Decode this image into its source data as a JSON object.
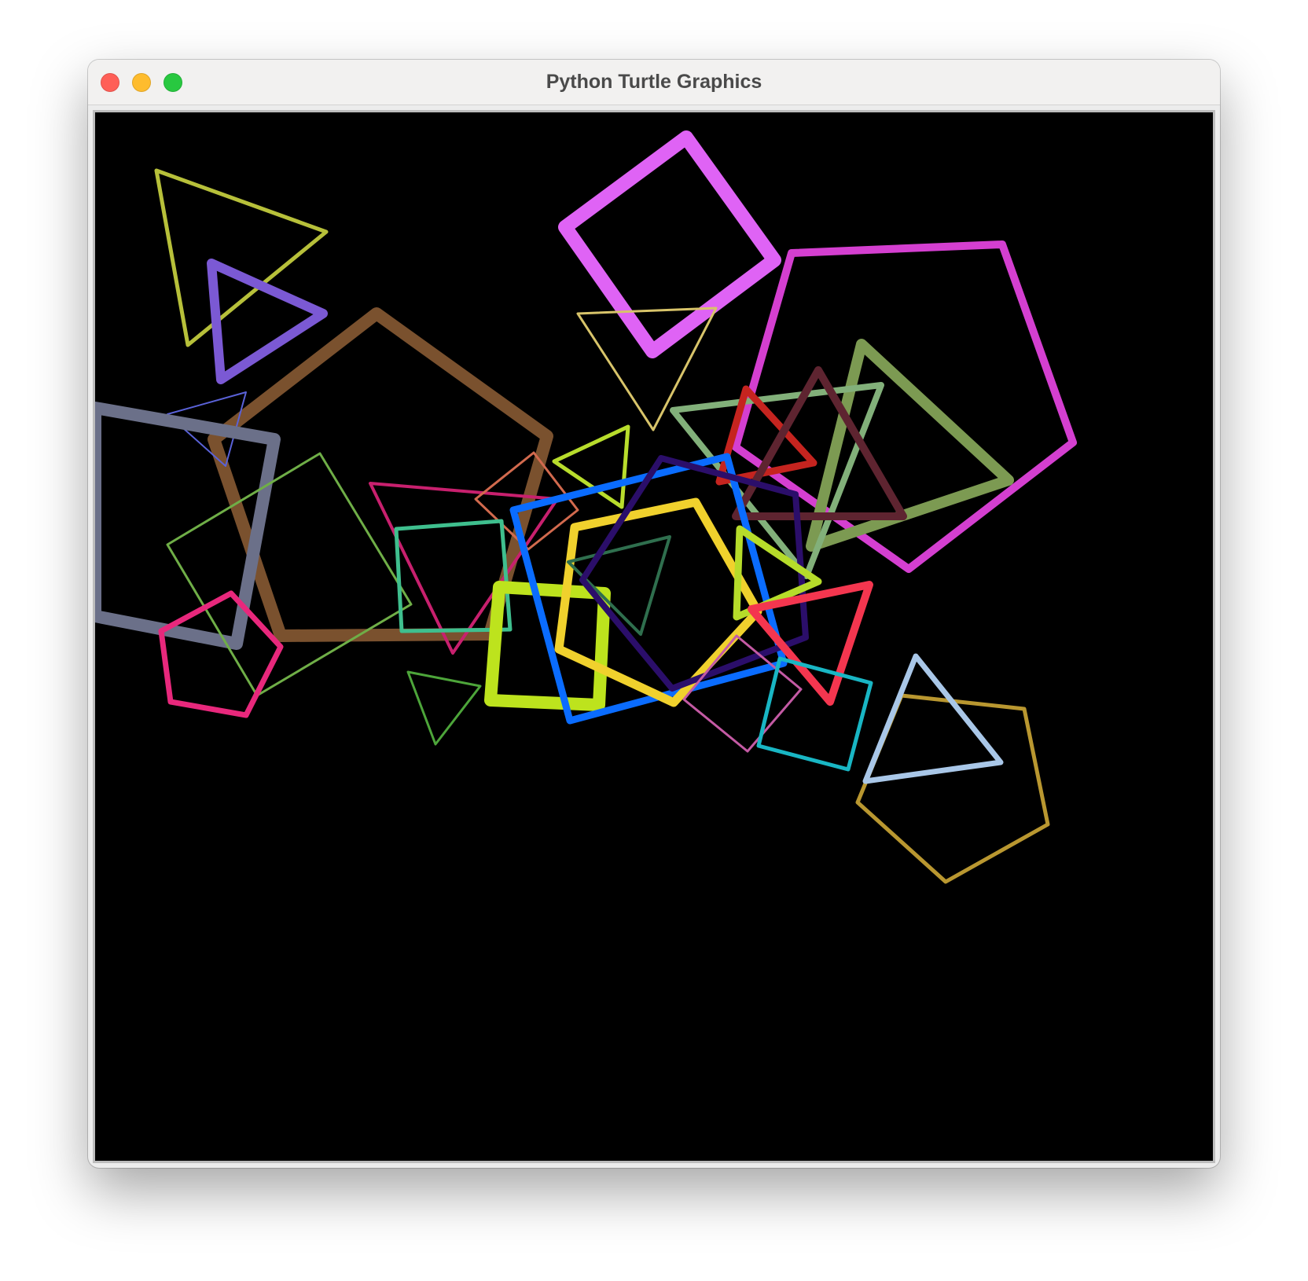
{
  "window": {
    "title": "Python Turtle Graphics",
    "controls": [
      "close-button",
      "minimize-button",
      "zoom-button"
    ]
  },
  "canvas": {
    "background": "#000000",
    "shapes": [
      {
        "name": "triangle-olive",
        "sides": 3,
        "color": "#b7c03a"
      },
      {
        "name": "triangle-violet",
        "sides": 3,
        "color": "#7b59d4"
      },
      {
        "name": "square-magenta",
        "sides": 4,
        "color": "#df63f5"
      },
      {
        "name": "triangle-tan",
        "sides": 3,
        "color": "#d8c46a"
      },
      {
        "name": "pentagon-pink-magenta",
        "sides": 5,
        "color": "#d43fd0"
      },
      {
        "name": "triangle-sage",
        "sides": 3,
        "color": "#7c9a52"
      },
      {
        "name": "pentagon-brown",
        "sides": 5,
        "color": "#7a512e"
      },
      {
        "name": "triangle-slate-blue-thin",
        "sides": 3,
        "color": "#5a62d8"
      },
      {
        "name": "square-slate-gray",
        "sides": 4,
        "color": "#6b7089"
      },
      {
        "name": "square-green-thin",
        "sides": 4,
        "color": "#6fae47"
      },
      {
        "name": "triangle-crimson-thin",
        "sides": 3,
        "color": "#c8206e"
      },
      {
        "name": "square-coral-thin",
        "sides": 4,
        "color": "#d26a4e"
      },
      {
        "name": "square-teal-green",
        "sides": 4,
        "color": "#3fbf8e"
      },
      {
        "name": "triangle-lime-small",
        "sides": 3,
        "color": "#b8dd2c"
      },
      {
        "name": "square-light-green",
        "sides": 4,
        "color": "#82b07a"
      },
      {
        "name": "triangle-red",
        "sides": 3,
        "color": "#c5241f"
      },
      {
        "name": "triangle-maroon",
        "sides": 3,
        "color": "#5e2430"
      },
      {
        "name": "pentagon-rose",
        "sides": 5,
        "color": "#e8287c"
      },
      {
        "name": "square-lime-thick",
        "sides": 4,
        "color": "#bde31d"
      },
      {
        "name": "square-blue",
        "sides": 4,
        "color": "#0a6cff"
      },
      {
        "name": "pentagon-yellow",
        "sides": 5,
        "color": "#f0d12d"
      },
      {
        "name": "triangle-dark-green",
        "sides": 3,
        "color": "#2f6f4e"
      },
      {
        "name": "square-indigo",
        "sides": 4,
        "color": "#2b0e6a"
      },
      {
        "name": "triangle-lime-right",
        "sides": 3,
        "color": "#b6dc2a"
      },
      {
        "name": "triangle-red-bright",
        "sides": 3,
        "color": "#f4364f"
      },
      {
        "name": "square-orchid-thin",
        "sides": 4,
        "color": "#c45aa4"
      },
      {
        "name": "square-cyan",
        "sides": 4,
        "color": "#19b6c4"
      },
      {
        "name": "triangle-green-thin",
        "sides": 3,
        "color": "#4da53a"
      },
      {
        "name": "pentagon-gold",
        "sides": 5,
        "color": "#b99730"
      },
      {
        "name": "triangle-light-blue",
        "sides": 3,
        "color": "#a9c7e8"
      }
    ]
  }
}
